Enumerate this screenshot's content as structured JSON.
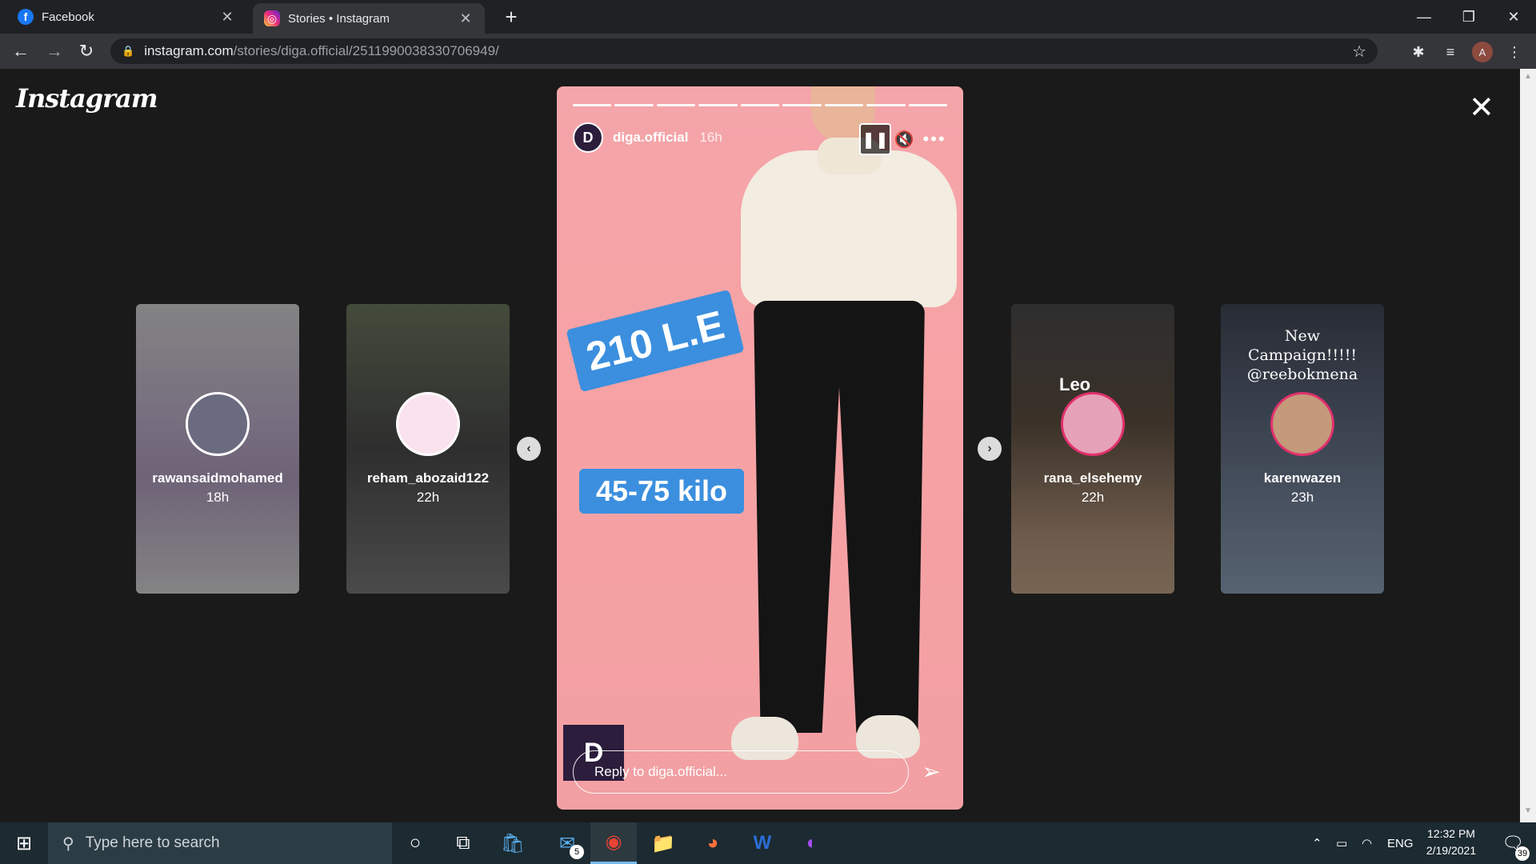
{
  "browser": {
    "tabs": [
      {
        "title": "Facebook",
        "icon": "facebook-icon"
      },
      {
        "title": "Stories • Instagram",
        "icon": "instagram-icon"
      }
    ],
    "url_host": "instagram.com",
    "url_path": "/stories/diga.official/2511990038330706949/",
    "profile_initial": "A"
  },
  "instagram": {
    "logo": "Instagram",
    "side_stories_left": [
      {
        "username": "rawansaidmohamed",
        "age": "18h"
      },
      {
        "username": "reham_abozaid122",
        "age": "22h"
      }
    ],
    "side_stories_right": [
      {
        "username": "rana_elsehemy",
        "age": "22h",
        "overlay_text": "Leo"
      },
      {
        "username": "karenwazen",
        "age": "23h",
        "overlay_text": "New Campaign!!!!! @reebokmena"
      }
    ],
    "current_story": {
      "username": "diga.official",
      "age": "16h",
      "progress_segments_done": 9,
      "progress_segments_total": 9,
      "sticker_price": "210 L.E",
      "sticker_weight": "45-75 kilo",
      "reply_placeholder": "Reply to diga.official...",
      "brand_letter": "D"
    }
  },
  "taskbar": {
    "search_placeholder": "Type here to search",
    "mail_badge": "5",
    "language": "ENG",
    "time": "12:32 PM",
    "date": "2/19/2021",
    "notifications": "39"
  },
  "colors": {
    "story_bg": "#f4a5a9",
    "sticker_blue": "#3b8fde",
    "taskbar": "#1c2a31",
    "chrome_dark": "#202124"
  }
}
